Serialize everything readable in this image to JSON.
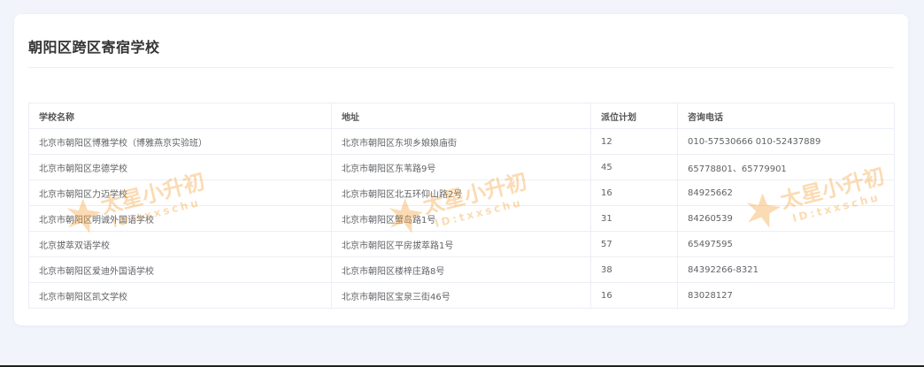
{
  "section": {
    "title": "朝阳区跨区寄宿学校"
  },
  "table": {
    "headers": [
      "学校名称",
      "地址",
      "派位计划",
      "咨询电话"
    ],
    "rows": [
      [
        "北京市朝阳区博雅学校（博雅燕京实验班）",
        "北京市朝阳区东坝乡娘娘庙街",
        "12",
        "010-57530666 010-52437889"
      ],
      [
        "北京市朝阳区忠德学校",
        "北京市朝阳区东苇路9号",
        "45",
        "65778801、65779901"
      ],
      [
        "北京市朝阳区力迈学校",
        "北京市朝阳区北五环仰山路2号",
        "16",
        "84925662"
      ],
      [
        "北京市朝阳区明诚外国语学校",
        "北京市朝阳区蟹岛路1号",
        "31",
        "84260539"
      ],
      [
        "北京拔萃双语学校",
        "北京市朝阳区平房拔萃路1号",
        "57",
        "65497595"
      ],
      [
        "北京市朝阳区爱迪外国语学校",
        "北京市朝阳区楼梓庄路8号",
        "38",
        "84392266-8321"
      ],
      [
        "北京市朝阳区凯文学校",
        "北京市朝阳区宝泉三街46号",
        "16",
        "83028127"
      ]
    ]
  },
  "watermark": {
    "brand": "太星小升初",
    "id": "ID:txxschu"
  },
  "colors": {
    "page_bg": "#f1f5fb",
    "card_bg": "#ffffff",
    "border": "#ebeef5",
    "watermark_orange": "#f5a23a"
  }
}
